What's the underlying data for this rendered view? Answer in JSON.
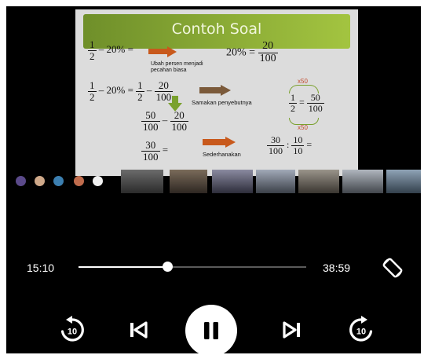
{
  "slide": {
    "title": "Contoh Soal",
    "row1_lhs_num": "1",
    "row1_lhs_den": "2",
    "row1_lhs_rest": "– 20% =",
    "row1_note": "Ubah persen menjadi\npecahan biasa",
    "row1_rhs_pre": "20% =",
    "row1_rhs_num": "20",
    "row1_rhs_den": "100",
    "row2_a_num": "1",
    "row2_a_den": "2",
    "row2_mid": "– 20% =",
    "row2_b_num": "1",
    "row2_b_den": "2",
    "row2_c_num": "20",
    "row2_c_den": "100",
    "row2_note": "Samakan penyebutnya",
    "side_a_num": "1",
    "side_a_den": "2",
    "side_b_num": "50",
    "side_b_den": "100",
    "x50_top": "x50",
    "x50_bottom": "x50",
    "row3_a_num": "50",
    "row3_a_den": "100",
    "row3_b_num": "20",
    "row3_b_den": "100",
    "row4_a_num": "30",
    "row4_a_den": "100",
    "row4_note": "Sederhanakan",
    "row4_b_num": "30",
    "row4_b_den": "100",
    "row4_c_num": "10",
    "row4_c_den": "10",
    "minus": "–",
    "equals": "=",
    "divide": ":"
  },
  "player": {
    "elapsed": "15:10",
    "duration": "38:59",
    "progress_fraction": 0.389,
    "rewind_seconds": "10",
    "forward_seconds": "10"
  },
  "colors": {
    "background": "#000000",
    "accent_arrow": "#c8591c",
    "slide_header": "#8db43a"
  }
}
